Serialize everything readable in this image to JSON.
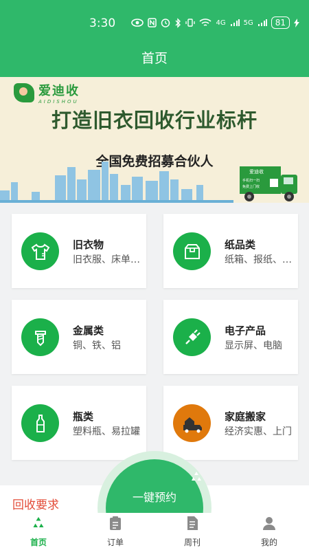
{
  "status_bar": {
    "time": "3:30",
    "network_4g": "4G",
    "network_5g": "5G",
    "battery": "81"
  },
  "header": {
    "title": "首页"
  },
  "banner": {
    "logo_cn": "爱迪收",
    "logo_en": "AIDISHOU",
    "slogan": "打造旧衣回收行业标杆",
    "recruit": "全国免费招募合伙人",
    "truck_brand": "爱迪收",
    "truck_line1": "手机扫一扫",
    "truck_line2": "免费上门收"
  },
  "categories": [
    {
      "title": "旧衣物",
      "sub": "旧衣服、床单、被套",
      "icon": "clothes-icon"
    },
    {
      "title": "纸品类",
      "sub": "纸箱、报纸、书本",
      "icon": "paper-box-icon"
    },
    {
      "title": "金属类",
      "sub": "铜、铁、铝",
      "icon": "screw-icon"
    },
    {
      "title": "电子产品",
      "sub": "显示屏、电脑",
      "icon": "plug-icon"
    },
    {
      "title": "瓶类",
      "sub": "塑料瓶、易拉罐",
      "icon": "bottle-icon"
    },
    {
      "title": "家庭搬家",
      "sub": "经济实惠、上门",
      "icon": "moving-truck-icon"
    }
  ],
  "recycle_requirements": {
    "label": "回收要求"
  },
  "fab": {
    "label": "一键预约",
    "icon": "recycle-icon"
  },
  "tabs": [
    {
      "label": "首页",
      "icon": "recycle-icon",
      "active": true
    },
    {
      "label": "订单",
      "icon": "clipboard-icon",
      "active": false
    },
    {
      "label": "周刊",
      "icon": "document-icon",
      "active": false
    },
    {
      "label": "我的",
      "icon": "user-icon",
      "active": false
    }
  ],
  "colors": {
    "primary_green": "#2fb86a",
    "icon_green": "#1bb04a",
    "orange": "#e0790c",
    "red_text": "#e34d3a"
  }
}
